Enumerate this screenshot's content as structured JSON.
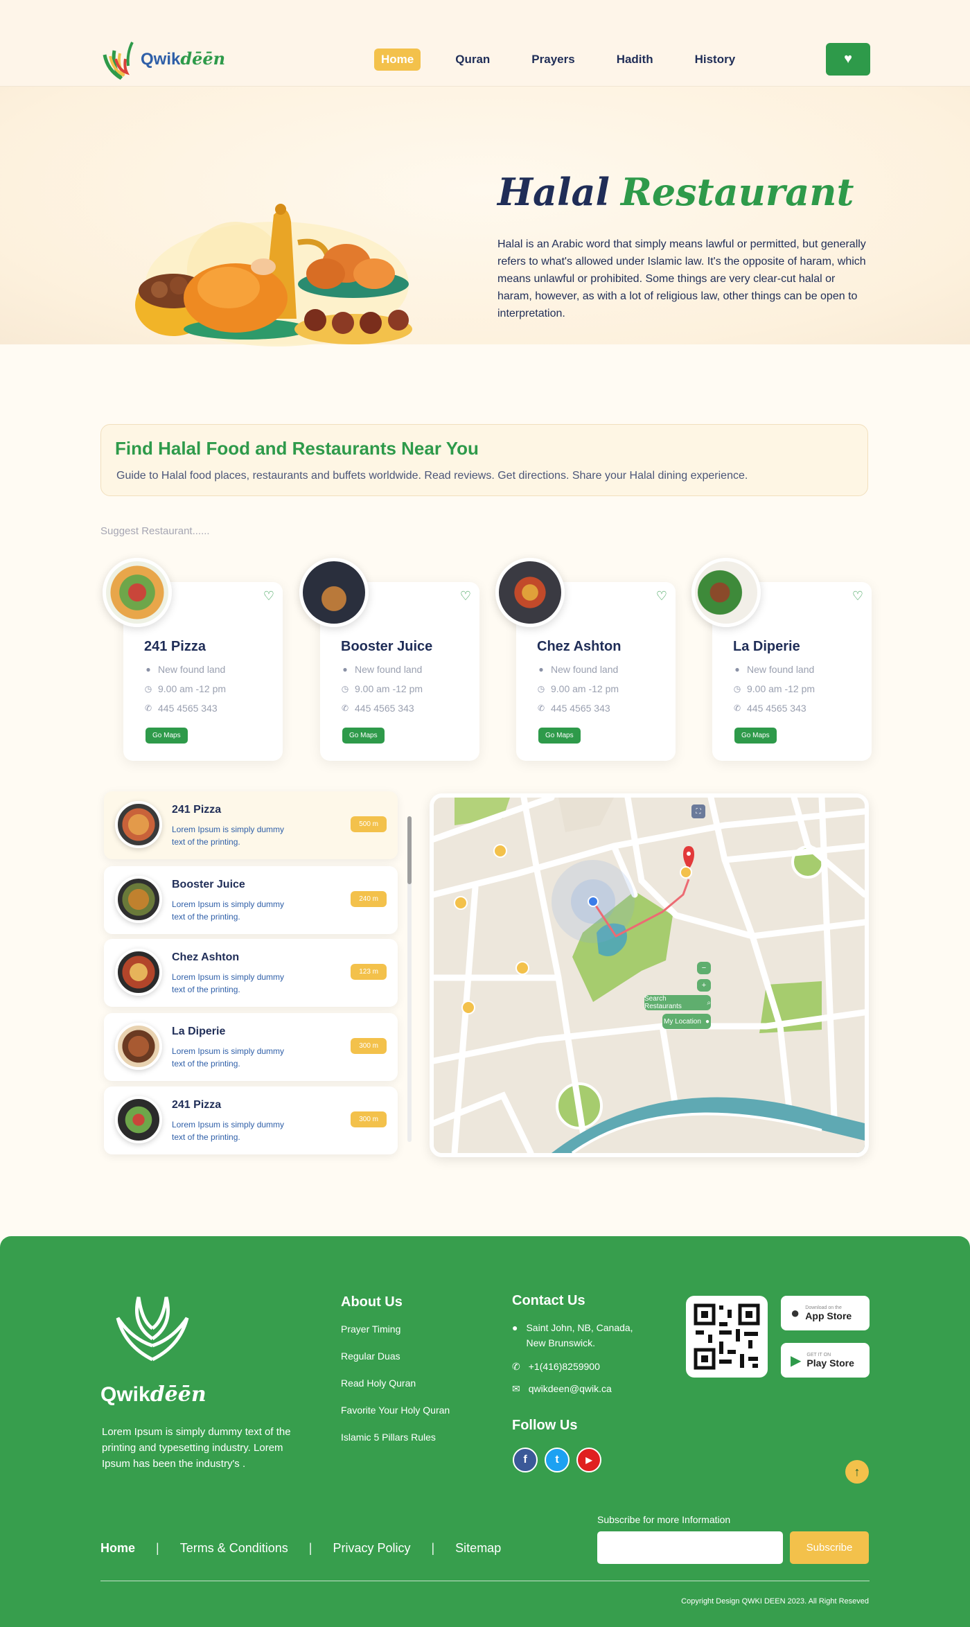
{
  "header": {
    "logo": {
      "part1": "Qwik",
      "part2": "dēēn"
    },
    "nav": [
      "Home",
      "Quran",
      "Prayers",
      "Hadith",
      "History"
    ],
    "fav_icon": "heart-icon"
  },
  "hero": {
    "title_part1": "Halal",
    "title_part2": "Restaurant",
    "description": "Halal is an Arabic word that simply means lawful or permitted, but generally refers to what's allowed under Islamic law. It's the opposite of haram, which means unlawful or prohibited. Some things are very clear-cut halal or haram, however, as with a lot of religious law, other things can be open to interpretation."
  },
  "find": {
    "title": "Find Halal Food and Restaurants Near You",
    "subtitle": "Guide to Halal food places, restaurants and buffets worldwide. Read reviews. Get directions. Share your Halal dining experience."
  },
  "suggest_label": "Suggest Restaurant......",
  "cards": [
    {
      "name": "241 Pizza",
      "address": "New found land",
      "hours": "9.00 am -12 pm",
      "phone": "445 4565 343",
      "button": "Go Maps"
    },
    {
      "name": "Booster Juice",
      "address": "New found land",
      "hours": "9.00 am -12 pm",
      "phone": "445 4565 343",
      "button": "Go Maps"
    },
    {
      "name": "Chez Ashton",
      "address": "New found land",
      "hours": "9.00 am -12 pm",
      "phone": "445 4565 343",
      "button": "Go Maps"
    },
    {
      "name": "La Diperie",
      "address": "New found land",
      "hours": "9.00 am -12 pm",
      "phone": "445 4565 343",
      "button": "Go Maps"
    }
  ],
  "list": [
    {
      "name": "241 Pizza",
      "desc": "Lorem Ipsum is simply dummy text of the printing.",
      "distance": "500 m"
    },
    {
      "name": "Booster Juice",
      "desc": "Lorem Ipsum is simply dummy text of the printing.",
      "distance": "240 m"
    },
    {
      "name": "Chez Ashton",
      "desc": "Lorem Ipsum is simply dummy text of the printing.",
      "distance": "123 m"
    },
    {
      "name": "La Diperie",
      "desc": "Lorem Ipsum is simply dummy text of the printing.",
      "distance": "300 m"
    },
    {
      "name": "241 Pizza",
      "desc": "Lorem Ipsum is simply dummy text of the printing.",
      "distance": "300 m"
    }
  ],
  "map": {
    "zoom_out": "−",
    "zoom_in": "+",
    "search_btn": "Search Restaurants",
    "location_btn": "My Location"
  },
  "footer": {
    "logo_part1": "Qwik",
    "logo_part2": "dēēn",
    "description": "Lorem Ipsum is simply dummy text of the printing and typesetting industry.  Lorem Ipsum has been the industry's .",
    "about_title": "About Us",
    "about_links": [
      "Prayer Timing",
      "Regular Duas",
      "Read Holy Quran",
      "Favorite Your Holy Quran",
      "Islamic 5 Pillars Rules"
    ],
    "contact_title": "Contact Us",
    "address": "Saint John, NB, Canada, New Brunswick.",
    "phone": "+1(416)8259900",
    "email": "qwikdeen@qwik.ca",
    "follow_title": "Follow Us",
    "app_store_small": "Download on the",
    "app_store": "App Store",
    "play_store_small": "GET IT ON",
    "play_store": "Play Store",
    "bottom_nav": [
      "Home",
      "Terms & Conditions",
      "Privacy Policy",
      "Sitemap"
    ],
    "subscribe_label": "Subscribe for more Information",
    "subscribe_btn": "Subscribe",
    "copyright": "Copyright Design QWKI DEEN 2023.  All Right Reseved"
  }
}
